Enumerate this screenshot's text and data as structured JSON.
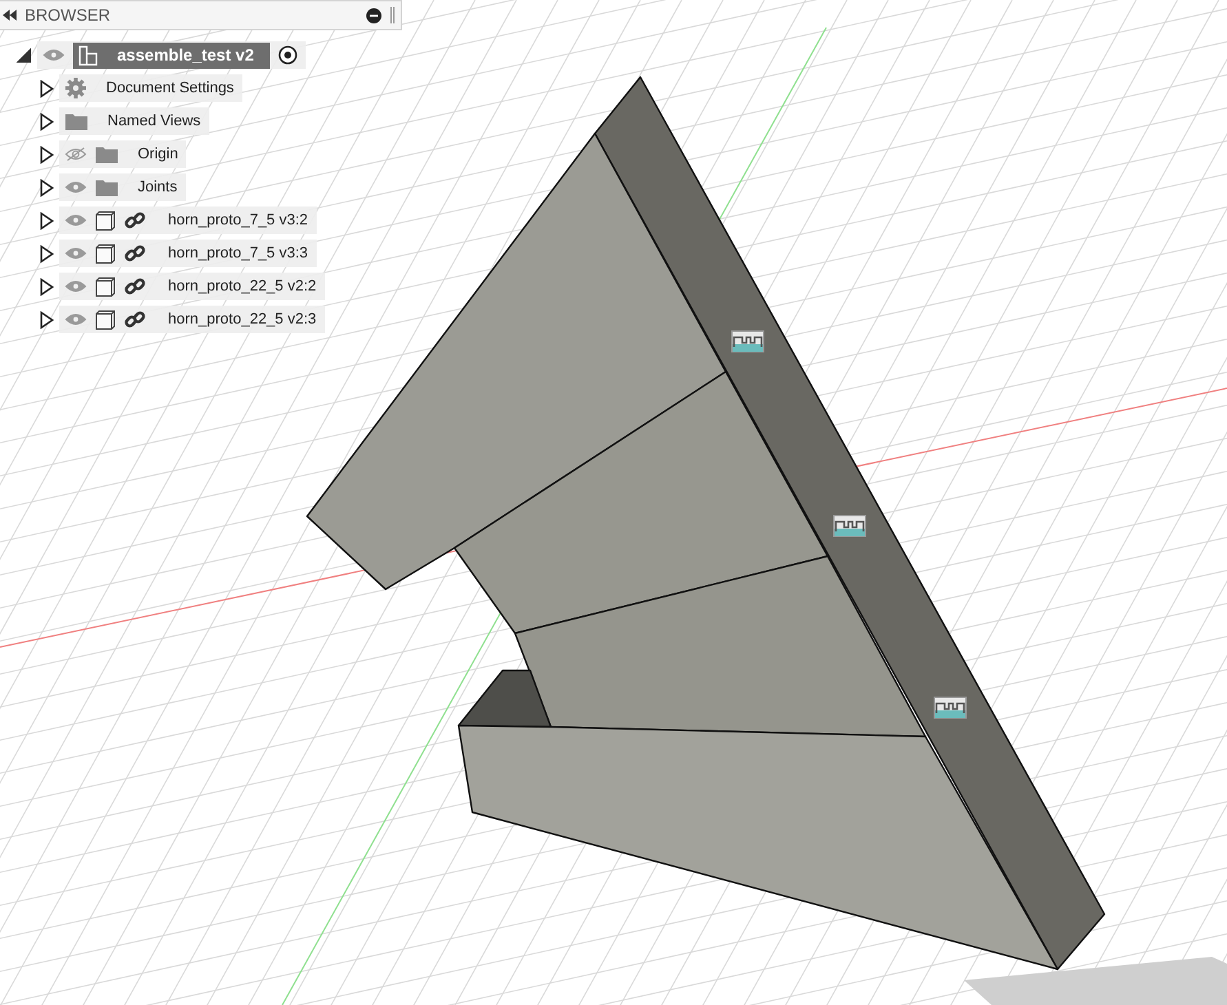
{
  "browser": {
    "title": "BROWSER",
    "root": {
      "label": "assemble_test v2",
      "expanded": true,
      "visible": true,
      "active": true,
      "children": [
        {
          "label": "Document Settings",
          "kind": "settings",
          "expanded": false
        },
        {
          "label": "Named Views",
          "kind": "folder",
          "expanded": false
        },
        {
          "label": "Origin",
          "kind": "folder",
          "expanded": false,
          "visible": false
        },
        {
          "label": "Joints",
          "kind": "folder",
          "expanded": false,
          "visible": true
        },
        {
          "label": "horn_proto_7_5 v3:2",
          "kind": "linked-component",
          "expanded": false,
          "visible": true
        },
        {
          "label": "horn_proto_7_5 v3:3",
          "kind": "linked-component",
          "expanded": false,
          "visible": true
        },
        {
          "label": "horn_proto_22_5 v2:2",
          "kind": "linked-component",
          "expanded": false,
          "visible": true
        },
        {
          "label": "horn_proto_22_5 v2:3",
          "kind": "linked-component",
          "expanded": false,
          "visible": true
        }
      ]
    }
  }
}
